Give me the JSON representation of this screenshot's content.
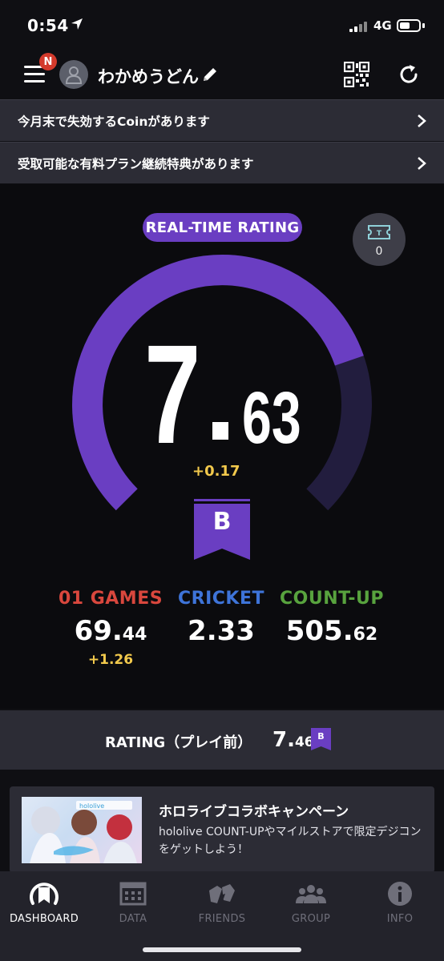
{
  "status_bar": {
    "time": "0:54",
    "network": "4G"
  },
  "header": {
    "menu_badge": "N",
    "username": "わかめうどん"
  },
  "notices": [
    {
      "text": "今月末で失効するCoinがあります"
    },
    {
      "text": "受取可能な有料プラン継続特典があります"
    }
  ],
  "rating": {
    "pill_label": "REAL-TIME RATING",
    "ticket_count": "0",
    "value_int": "7",
    "value_dec": "63",
    "delta": "+0.17",
    "rank": "B",
    "gauge_fill_fraction": 0.763,
    "colors": {
      "accent": "#6a3ec2",
      "track": "#221d3e"
    }
  },
  "stats": [
    {
      "label": "01 GAMES",
      "int": "69.",
      "dec": "44",
      "delta": "+1.26",
      "color": "#d9473d"
    },
    {
      "label": "CRICKET",
      "int": "2.33",
      "dec": "",
      "delta": "",
      "color": "#3e74d9"
    },
    {
      "label": "COUNT-UP",
      "int": "505.",
      "dec": "62",
      "delta": "",
      "color": "#58a33e"
    }
  ],
  "rating_before": {
    "label": "RATING（プレイ前）",
    "int": "7.",
    "dec": "46",
    "rank": "B"
  },
  "campaign": {
    "title": "ホロライブコラボキャンペーン",
    "description": "hololive COUNT-UPやマイルストアで限定デジコンをゲットしよう！",
    "image_caption": "hololive"
  },
  "tabs": [
    {
      "label": "DASHBOARD",
      "icon": "dashboard-icon",
      "active": true
    },
    {
      "label": "DATA",
      "icon": "data-icon",
      "active": false
    },
    {
      "label": "FRIENDS",
      "icon": "friends-icon",
      "active": false
    },
    {
      "label": "GROUP",
      "icon": "group-icon",
      "active": false
    },
    {
      "label": "INFO",
      "icon": "info-icon",
      "active": false
    }
  ]
}
